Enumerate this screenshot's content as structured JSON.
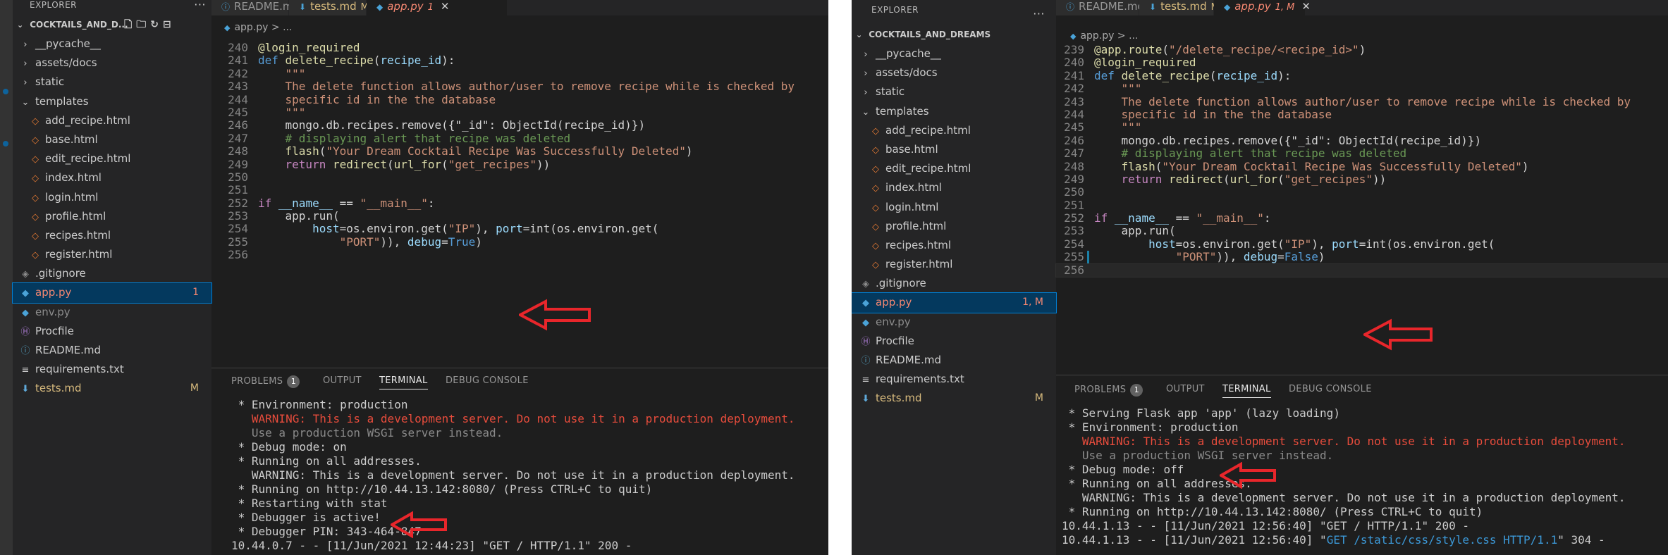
{
  "left": {
    "explorer_title": "EXPLORER",
    "more_actions": "···",
    "project_name": "COCKTAILS_AND_D...",
    "tree": [
      {
        "kind": "folder",
        "label": "__pycache__",
        "open": false,
        "depth": 1
      },
      {
        "kind": "folder",
        "label": "assets/docs",
        "open": false,
        "depth": 1
      },
      {
        "kind": "folder",
        "label": "static",
        "open": false,
        "depth": 1
      },
      {
        "kind": "folder",
        "label": "templates",
        "open": true,
        "depth": 1
      },
      {
        "kind": "html",
        "label": "add_recipe.html",
        "depth": 2
      },
      {
        "kind": "html",
        "label": "base.html",
        "depth": 2
      },
      {
        "kind": "html",
        "label": "edit_recipe.html",
        "depth": 2
      },
      {
        "kind": "html",
        "label": "index.html",
        "depth": 2
      },
      {
        "kind": "html",
        "label": "login.html",
        "depth": 2
      },
      {
        "kind": "html",
        "label": "profile.html",
        "depth": 2
      },
      {
        "kind": "html",
        "label": "recipes.html",
        "depth": 2
      },
      {
        "kind": "html",
        "label": "register.html",
        "depth": 2
      },
      {
        "kind": "git",
        "label": ".gitignore",
        "depth": 1
      },
      {
        "kind": "py",
        "label": "app.py",
        "depth": 1,
        "badge": "1",
        "state": "error",
        "selected": true
      },
      {
        "kind": "py",
        "label": "env.py",
        "depth": 1,
        "state": "dim"
      },
      {
        "kind": "proc",
        "label": "Procfile",
        "depth": 1
      },
      {
        "kind": "info",
        "label": "README.md",
        "depth": 1
      },
      {
        "kind": "txt",
        "label": "requirements.txt",
        "depth": 1
      },
      {
        "kind": "md",
        "label": "tests.md",
        "depth": 1,
        "badge": "M",
        "state": "modified"
      }
    ],
    "tabs": [
      {
        "label": "README.md",
        "flag": "",
        "icon": "info-icon"
      },
      {
        "label": "tests.md",
        "flag": "M",
        "icon": "download-icon"
      },
      {
        "label": "app.py",
        "flag": "1",
        "icon": "python-icon",
        "active": true,
        "close": "✕"
      }
    ],
    "breadcrumb": "app.py > ...",
    "code": [
      {
        "n": "240",
        "t": "@login_required",
        "s": "dec"
      },
      {
        "n": "241",
        "t": "def delete_recipe(recipe_id):",
        "s": "def"
      },
      {
        "n": "242",
        "t": "    \"\"\"",
        "s": "str"
      },
      {
        "n": "243",
        "t": "    The delete function allows author/user to remove recipe while is checked by",
        "s": "str"
      },
      {
        "n": "244",
        "t": "    specific id in the the database",
        "s": "str"
      },
      {
        "n": "245",
        "t": "    \"\"\"",
        "s": "str"
      },
      {
        "n": "246",
        "t": "    mongo.db.recipes.remove({\"_id\": ObjectId(recipe_id)})",
        "s": "plain"
      },
      {
        "n": "247",
        "t": "    # displaying alert that recipe was deleted",
        "s": "cmt"
      },
      {
        "n": "248",
        "t": "    flash(\"Your Dream Cocktail Recipe Was Successfully Deleted\")",
        "s": "fnstr"
      },
      {
        "n": "249",
        "t": "    return redirect(url_for(\"get_recipes\"))",
        "s": "ret"
      },
      {
        "n": "250",
        "t": "",
        "s": "plain"
      },
      {
        "n": "251",
        "t": "",
        "s": "plain"
      },
      {
        "n": "252",
        "t": "if __name__ == \"__main__\":",
        "s": "if"
      },
      {
        "n": "253",
        "t": "    app.run(",
        "s": "plain"
      },
      {
        "n": "254",
        "t": "        host=os.environ.get(\"IP\"), port=int(os.environ.get(",
        "s": "host"
      },
      {
        "n": "255",
        "t": "            \"PORT\")), debug=True)",
        "s": "debugtrue"
      },
      {
        "n": "256",
        "t": "",
        "s": "plain"
      }
    ],
    "panel_tabs": {
      "problems": "PROBLEMS",
      "problems_count": "1",
      "output": "OUTPUT",
      "terminal": "TERMINAL",
      "debug_console": "DEBUG CONSOLE"
    },
    "terminal": [
      {
        "t": " * Environment: production",
        "c": ""
      },
      {
        "t": "   WARNING: This is a development server. Do not use it in a production deployment.",
        "c": "warn"
      },
      {
        "t": "   Use a production WSGI server instead.",
        "c": "dim"
      },
      {
        "t": " * Debug mode: on",
        "c": ""
      },
      {
        "t": " * Running on all addresses.",
        "c": ""
      },
      {
        "t": "   WARNING: This is a development server. Do not use it in a production deployment.",
        "c": ""
      },
      {
        "t": " * Running on http://10.44.13.142:8080/ (Press CTRL+C to quit)",
        "c": ""
      },
      {
        "t": " * Restarting with stat",
        "c": ""
      },
      {
        "t": " * Debugger is active!",
        "c": ""
      },
      {
        "t": " * Debugger PIN: 343-464-847",
        "c": ""
      },
      {
        "t": "10.44.0.7 - - [11/Jun/2021 12:44:23] \"GET / HTTP/1.1\" 200 -",
        "c": ""
      }
    ]
  },
  "right": {
    "explorer_title": "EXPLORER",
    "more_actions": "···",
    "project_name": "COCKTAILS_AND_DREAMS",
    "tree": [
      {
        "kind": "folder",
        "label": "__pycache__",
        "open": false,
        "depth": 1
      },
      {
        "kind": "folder",
        "label": "assets/docs",
        "open": false,
        "depth": 1
      },
      {
        "kind": "folder",
        "label": "static",
        "open": false,
        "depth": 1
      },
      {
        "kind": "folder",
        "label": "templates",
        "open": true,
        "depth": 1
      },
      {
        "kind": "html",
        "label": "add_recipe.html",
        "depth": 2
      },
      {
        "kind": "html",
        "label": "base.html",
        "depth": 2
      },
      {
        "kind": "html",
        "label": "edit_recipe.html",
        "depth": 2
      },
      {
        "kind": "html",
        "label": "index.html",
        "depth": 2
      },
      {
        "kind": "html",
        "label": "login.html",
        "depth": 2
      },
      {
        "kind": "html",
        "label": "profile.html",
        "depth": 2
      },
      {
        "kind": "html",
        "label": "recipes.html",
        "depth": 2
      },
      {
        "kind": "html",
        "label": "register.html",
        "depth": 2
      },
      {
        "kind": "git",
        "label": ".gitignore",
        "depth": 1
      },
      {
        "kind": "py",
        "label": "app.py",
        "depth": 1,
        "badge": "1, M",
        "state": "error",
        "selected": true
      },
      {
        "kind": "py",
        "label": "env.py",
        "depth": 1,
        "state": "dim"
      },
      {
        "kind": "proc",
        "label": "Procfile",
        "depth": 1
      },
      {
        "kind": "info",
        "label": "README.md",
        "depth": 1
      },
      {
        "kind": "txt",
        "label": "requirements.txt",
        "depth": 1
      },
      {
        "kind": "md",
        "label": "tests.md",
        "depth": 1,
        "badge": "M",
        "state": "modified"
      }
    ],
    "tabs": [
      {
        "label": "README.md",
        "flag": "",
        "icon": "info-icon"
      },
      {
        "label": "tests.md",
        "flag": "M",
        "icon": "download-icon"
      },
      {
        "label": "app.py",
        "flag": "1, M",
        "icon": "python-icon",
        "active": true,
        "close": "✕"
      }
    ],
    "breadcrumb": "app.py > ...",
    "code": [
      {
        "n": "239",
        "t": "@app.route(\"/delete_recipe/<recipe_id>\")",
        "s": "route"
      },
      {
        "n": "240",
        "t": "@login_required",
        "s": "dec"
      },
      {
        "n": "241",
        "t": "def delete_recipe(recipe_id):",
        "s": "def"
      },
      {
        "n": "242",
        "t": "    \"\"\"",
        "s": "str"
      },
      {
        "n": "243",
        "t": "    The delete function allows author/user to remove recipe while is checked by",
        "s": "str"
      },
      {
        "n": "244",
        "t": "    specific id in the the database",
        "s": "str"
      },
      {
        "n": "245",
        "t": "    \"\"\"",
        "s": "str"
      },
      {
        "n": "246",
        "t": "    mongo.db.recipes.remove({\"_id\": ObjectId(recipe_id)})",
        "s": "plain"
      },
      {
        "n": "247",
        "t": "    # displaying alert that recipe was deleted",
        "s": "cmt"
      },
      {
        "n": "248",
        "t": "    flash(\"Your Dream Cocktail Recipe Was Successfully Deleted\")",
        "s": "fnstr"
      },
      {
        "n": "249",
        "t": "    return redirect(url_for(\"get_recipes\"))",
        "s": "ret"
      },
      {
        "n": "250",
        "t": "",
        "s": "plain"
      },
      {
        "n": "251",
        "t": "",
        "s": "plain"
      },
      {
        "n": "252",
        "t": "if __name__ == \"__main__\":",
        "s": "if"
      },
      {
        "n": "253",
        "t": "    app.run(",
        "s": "plain"
      },
      {
        "n": "254",
        "t": "        host=os.environ.get(\"IP\"), port=int(os.environ.get(",
        "s": "host"
      },
      {
        "n": "255",
        "t": "            \"PORT\")), debug=False)",
        "s": "debugfalse",
        "modified": true
      },
      {
        "n": "256",
        "t": "",
        "s": "plain",
        "current": true
      }
    ],
    "panel_tabs": {
      "problems": "PROBLEMS",
      "problems_count": "1",
      "output": "OUTPUT",
      "terminal": "TERMINAL",
      "debug_console": "DEBUG CONSOLE"
    },
    "terminal": [
      {
        "t": " * Serving Flask app 'app' (lazy loading)",
        "c": ""
      },
      {
        "t": " * Environment: production",
        "c": ""
      },
      {
        "t": "   WARNING: This is a development server. Do not use it in a production deployment.",
        "c": "warn"
      },
      {
        "t": "   Use a production WSGI server instead.",
        "c": "dim"
      },
      {
        "t": " * Debug mode: off",
        "c": ""
      },
      {
        "t": " * Running on all addresses.",
        "c": ""
      },
      {
        "t": "   WARNING: This is a development server. Do not use it in a production deployment.",
        "c": ""
      },
      {
        "t": " * Running on http://10.44.13.142:8080/ (Press CTRL+C to quit)",
        "c": ""
      },
      {
        "t": "10.44.1.13 - - [11/Jun/2021 12:56:40] \"GET / HTTP/1.1\" 200 -",
        "c": ""
      },
      {
        "t": "10.44.1.13 - - [11/Jun/2021 12:56:40] \"GET /static/css/style.css HTTP/1.1\" 304 -",
        "c": "link"
      }
    ]
  },
  "colors": {
    "annotation_arrow": "#e8262b",
    "editor_bg": "#1e1e1e",
    "sidebar_bg": "#252526",
    "selection": "#04395e"
  }
}
